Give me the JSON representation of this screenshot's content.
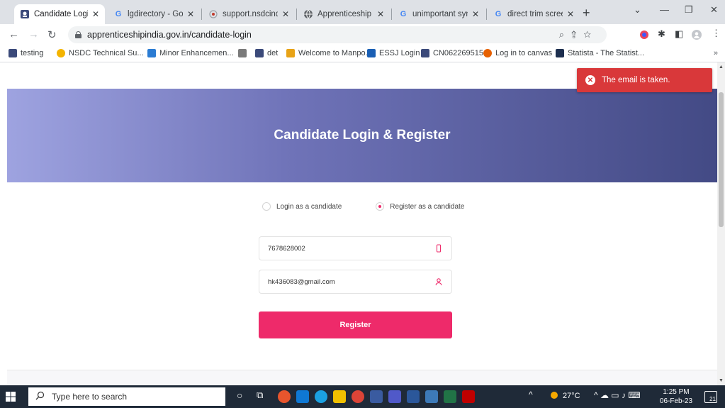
{
  "browser": {
    "tabs": [
      {
        "title": "Candidate Login | A",
        "icon": "apprenticeship-favicon"
      },
      {
        "title": "lgdirectory - Googl",
        "icon": "google-icon"
      },
      {
        "title": "support.nsdcindia.",
        "icon": "nsdc-favicon"
      },
      {
        "title": "Apprenticeship Por",
        "icon": "globe-icon"
      },
      {
        "title": "unimportant synon",
        "icon": "google-icon"
      },
      {
        "title": "direct trim screens",
        "icon": "google-icon"
      }
    ],
    "url": "apprenticeshipindia.gov.in/candidate-login",
    "bookmarks": [
      "testing",
      "NSDC Technical Su...",
      "Minor Enhancemen...",
      "",
      "det",
      "Welcome to Manpo...",
      "ESSJ Login",
      "CN062269515",
      "Log in to canvas",
      "Statista - The Statist..."
    ],
    "bookmarks_more": "»"
  },
  "page": {
    "title": "Candidate Login & Register",
    "radio_login": "Login as a candidate",
    "radio_register": "Register as a candidate",
    "selected_option": "register",
    "mobile_value": "7678628002",
    "email_value": "hk436083@gmail.com",
    "register_label": "Register",
    "toast_message": "The email is taken.",
    "accent_color": "#ee2a6a",
    "toast_color": "#d9383a"
  },
  "taskbar": {
    "search_placeholder": "Type here to search",
    "temperature": "27°C",
    "time": "1:25 PM",
    "date": "06-Feb-23",
    "notification_count": "21"
  }
}
